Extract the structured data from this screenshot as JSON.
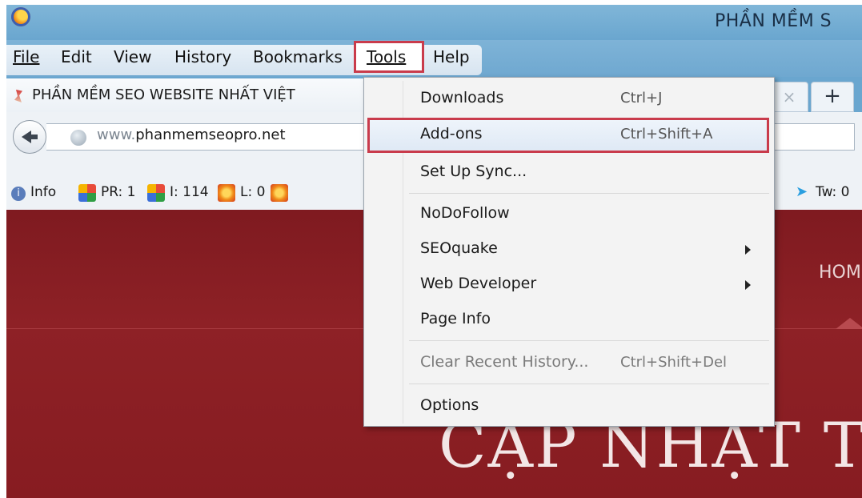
{
  "window": {
    "title": "PHẦN MỀM S"
  },
  "menubar": {
    "file": "File",
    "edit": "Edit",
    "view": "View",
    "history": "History",
    "bookmarks": "Bookmarks",
    "tools": "Tools",
    "help": "Help"
  },
  "tab": {
    "title": "PHẦN MỀM SEO WEBSITE NHẤT VIỆT",
    "close": "×",
    "new": "+"
  },
  "navbar": {
    "url_prefix": "www.",
    "url_domain": "phanmemseopro.net"
  },
  "seobar": {
    "info": "Info",
    "pr": "PR: 1",
    "i": "I: 114",
    "l": "L: 0",
    "tw": "Tw: 0"
  },
  "page": {
    "nav_home": "HOM",
    "hero_text": "CẬP NHẬT T"
  },
  "tools_menu": {
    "downloads": {
      "label": "Downloads",
      "shortcut": "Ctrl+J"
    },
    "addons": {
      "label": "Add-ons",
      "shortcut": "Ctrl+Shift+A"
    },
    "sync": {
      "label": "Set Up Sync..."
    },
    "nodofollow": {
      "label": "NoDoFollow"
    },
    "seoquake": {
      "label": "SEOquake"
    },
    "webdev": {
      "label": "Web Developer"
    },
    "pageinfo": {
      "label": "Page Info"
    },
    "clear": {
      "label": "Clear Recent History...",
      "shortcut": "Ctrl+Shift+Del"
    },
    "options": {
      "label": "Options"
    }
  },
  "colors": {
    "highlight_border": "#c93b4b",
    "page_bg": "#8a1d22",
    "titlebar": "#6aa6cf"
  }
}
